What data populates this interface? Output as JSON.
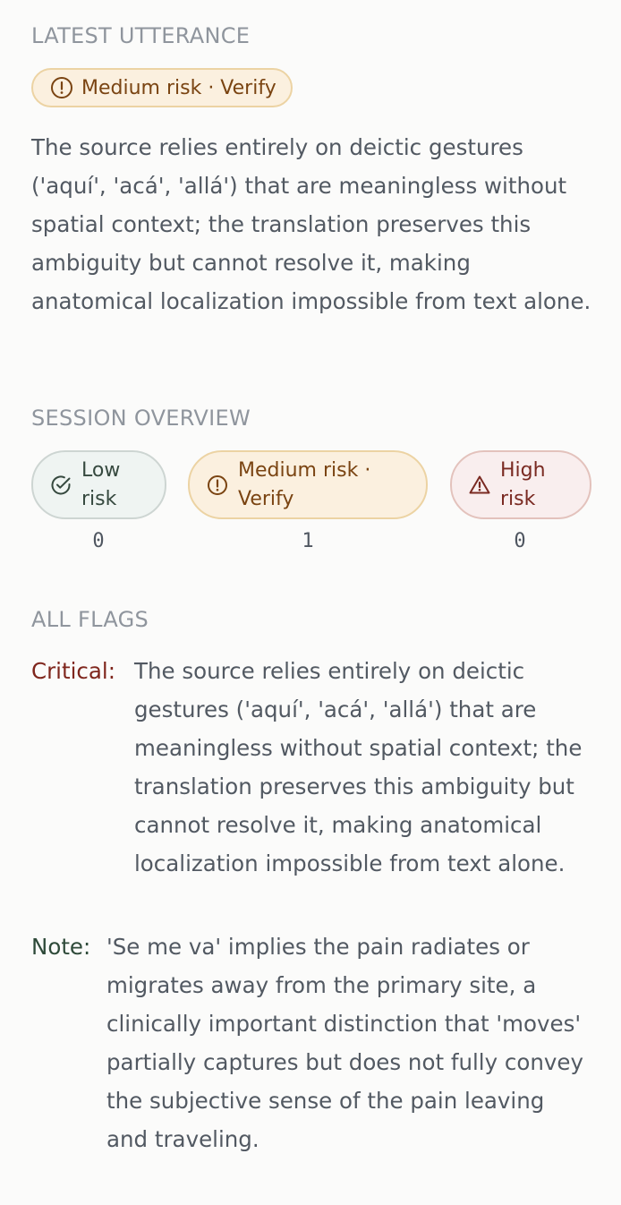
{
  "latest": {
    "heading": "LATEST UTTERANCE",
    "badge_label": "Medium risk · Verify",
    "text": "The source relies entirely on deictic gestures ('aquí', 'acá', 'allá') that are meaningless without spatial context; the translation preserves this ambiguity but cannot resolve it, making anatomical localization impossible from text alone."
  },
  "overview": {
    "heading": "SESSION OVERVIEW",
    "items": [
      {
        "label": "Low risk",
        "count": "0",
        "icon": "check-circle-icon",
        "color": "#36493f"
      },
      {
        "label": "Medium risk · Verify",
        "count": "1",
        "icon": "alert-circle-icon",
        "color": "#7a4412"
      },
      {
        "label": "High risk",
        "count": "0",
        "icon": "warning-triangle-icon",
        "color": "#7a2a22"
      }
    ]
  },
  "flags": {
    "heading": "ALL FLAGS",
    "items": [
      {
        "tag": "Critical:",
        "text": "The source relies entirely on deictic gestures ('aquí', 'acá', 'allá') that are meaningless without spatial context; the translation preserves this ambiguity but cannot resolve it, making anatomical localization impossible from text alone.",
        "color": "#7f261d"
      },
      {
        "tag": "Note:",
        "text": "'Se me va' implies the pain radiates or migrates away from the primary site, a clinically important distinction that 'moves' partially captures but does not fully convey the subjective sense of the pain leaving and traveling.",
        "color": "#2e4a39"
      }
    ]
  }
}
